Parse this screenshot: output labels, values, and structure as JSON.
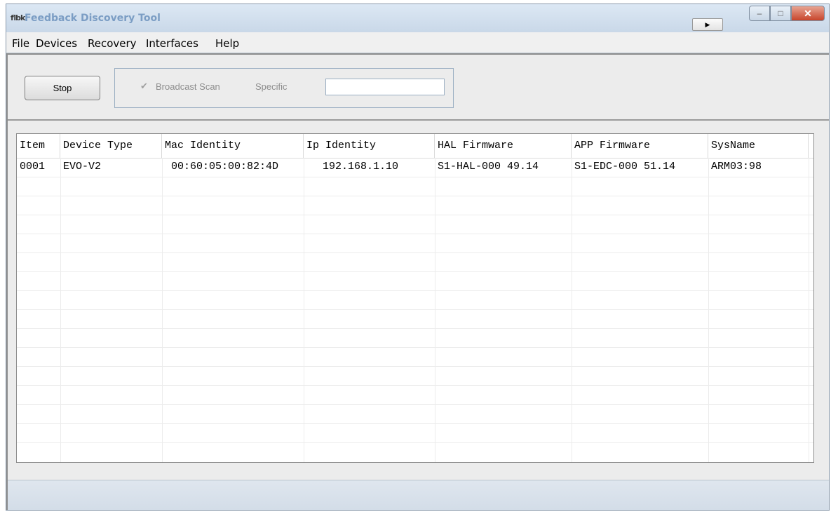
{
  "window": {
    "icon_text": "ﬂbk",
    "title": "Feedback Discovery Tool",
    "play_icon": "▶",
    "minimize_icon": "–",
    "maximize_icon": "□",
    "close_icon": "✕"
  },
  "menu": [
    "File",
    "Devices",
    "Recovery",
    "Interfaces",
    "Help"
  ],
  "toolbar": {
    "stop_label": "Stop",
    "broadcast_label": "Broadcast Scan",
    "broadcast_checked": true,
    "specific_label": "Specific",
    "specific_value": ""
  },
  "table": {
    "columns": [
      "Item",
      "Device Type",
      "Mac Identity",
      "Ip Identity",
      "HAL Firmware",
      "APP Firmware",
      "SysName"
    ],
    "rows": [
      [
        "0001",
        "EVO-V2",
        "00:60:05:00:82:4D",
        "192.168.1.10",
        "S1-HAL-000 49.14",
        "S1-EDC-000 51.14",
        "ARM03:98"
      ]
    ]
  }
}
